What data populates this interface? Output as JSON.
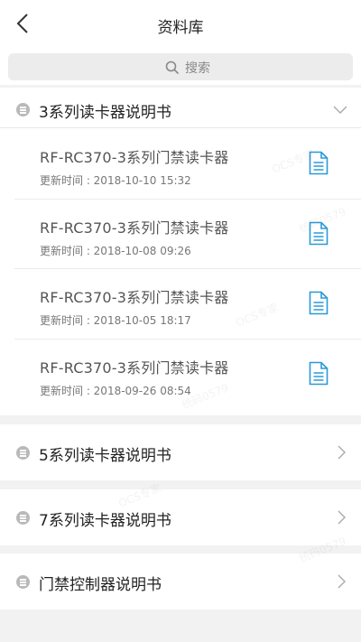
{
  "header": {
    "title": "资料库",
    "back_icon": "chevron-left-icon"
  },
  "search": {
    "placeholder": "搜索",
    "icon": "search-icon"
  },
  "sections": [
    {
      "label": "3系列读卡器说明书",
      "expanded": true,
      "documents": [
        {
          "title": "RF-RC370-3系列门禁读卡器",
          "updated": "更新时间 : 2018-10-10 15:32"
        },
        {
          "title": "RF-RC370-3系列门禁读卡器",
          "updated": "更新时间 : 2018-10-08 09:26"
        },
        {
          "title": "RF-RC370-3系列门禁读卡器",
          "updated": "更新时间 : 2018-10-05 18:17"
        },
        {
          "title": "RF-RC370-3系列门禁读卡器",
          "updated": "更新时间 : 2018-09-26 08:54"
        }
      ]
    },
    {
      "label": "5系列读卡器说明书",
      "expanded": false
    },
    {
      "label": "7系列读卡器说明书",
      "expanded": false
    },
    {
      "label": "门禁控制器说明书",
      "expanded": false
    }
  ],
  "colors": {
    "accent": "#2a9ad8",
    "dot": "#b9b9b9",
    "background": "#f2f2f2"
  },
  "watermarks": {
    "brand": "OCS专家",
    "code": "统码0579"
  }
}
